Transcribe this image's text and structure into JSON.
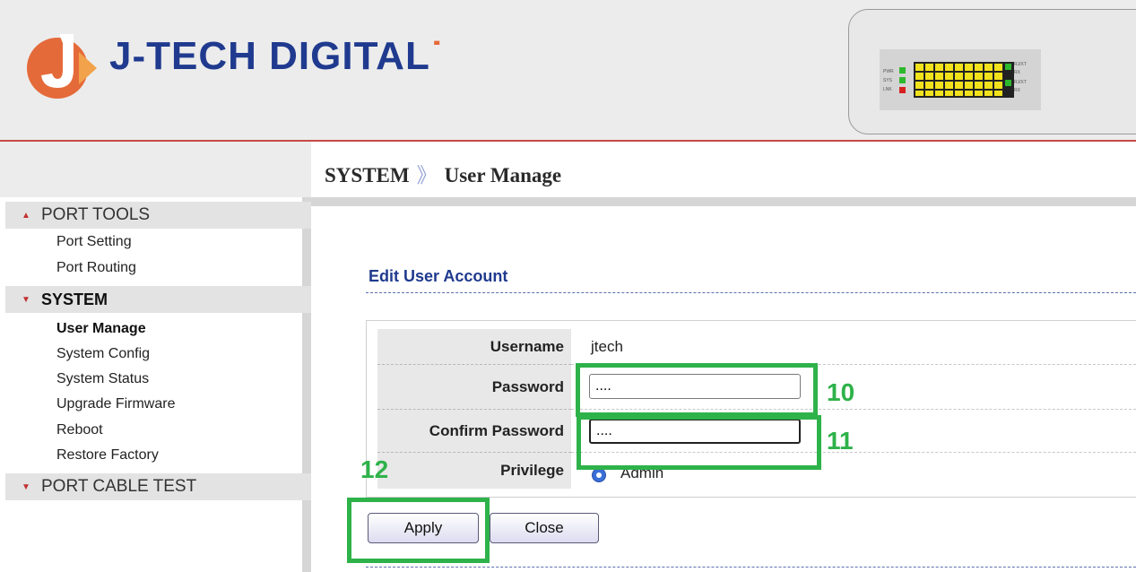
{
  "header": {
    "brand": "J-TECH DIGITAL",
    "brand_mark": "˙"
  },
  "device_panel": {
    "led_labels": [
      "PWR",
      "SYS",
      "LNK"
    ],
    "port_labels": [
      "RJ/XT",
      "RX",
      "RJ/XT",
      "RX"
    ]
  },
  "breadcrumb": {
    "parent": "SYSTEM",
    "separator": "》",
    "current": "User Manage"
  },
  "sidebar": {
    "sections": [
      {
        "label": "PORT TOOLS",
        "arrow": "▲",
        "items": [
          "Port Setting",
          "Port Routing"
        ]
      },
      {
        "label": "SYSTEM",
        "arrow": "▼",
        "items": [
          "User Manage",
          "System Config",
          "System Status",
          "Upgrade Firmware",
          "Reboot",
          "Restore Factory"
        ]
      },
      {
        "label": "PORT CABLE TEST",
        "arrow": "▼",
        "items": []
      }
    ],
    "current_item": "User Manage"
  },
  "form": {
    "title": "Edit User Account",
    "username_label": "Username",
    "username_value": "jtech",
    "password_label": "Password",
    "password_value": "....",
    "confirm_label": "Confirm Password",
    "confirm_value": "....",
    "privilege_label": "Privilege",
    "privilege_value": "Admin"
  },
  "buttons": {
    "apply": "Apply",
    "close": "Close"
  },
  "annotations": {
    "color": "#2eb24a",
    "labels": [
      "10",
      "11",
      "12"
    ]
  },
  "colors": {
    "brand_blue": "#1f3a8e",
    "brand_orange": "#e56a3a",
    "header_line": "#c44a45",
    "sidebar_arrow": "#c03030"
  }
}
